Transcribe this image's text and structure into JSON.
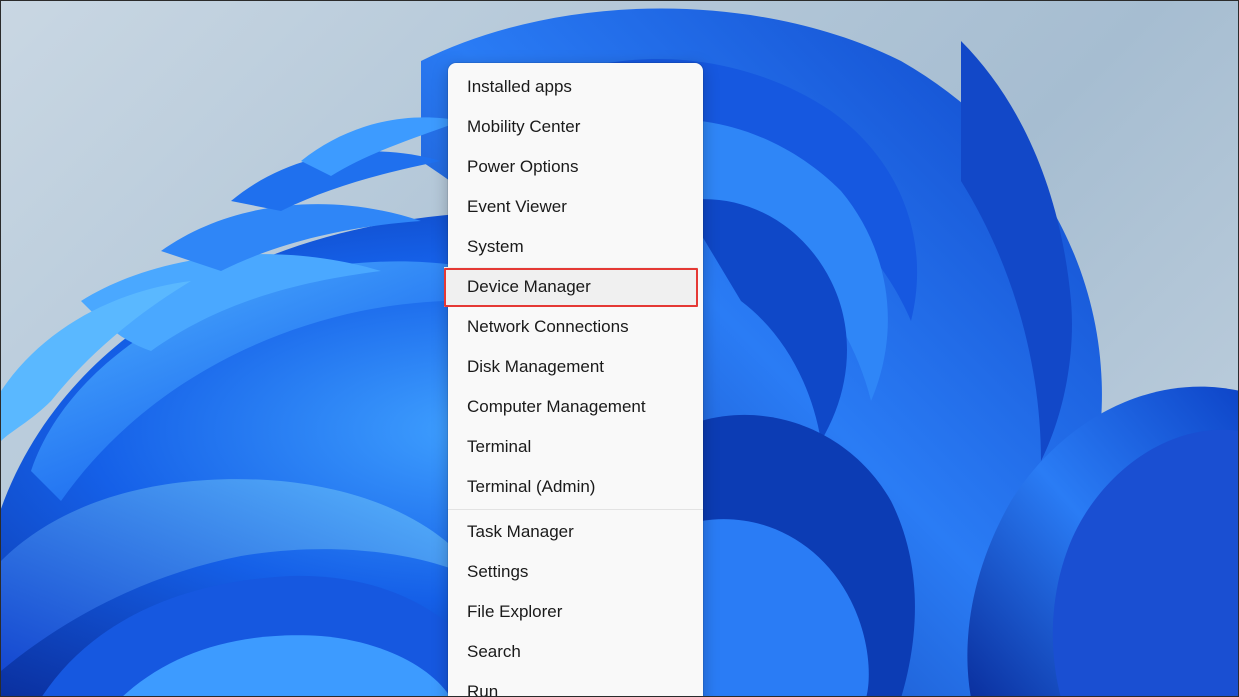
{
  "menu": {
    "group1": [
      {
        "label": "Installed apps"
      },
      {
        "label": "Mobility Center"
      },
      {
        "label": "Power Options"
      },
      {
        "label": "Event Viewer"
      },
      {
        "label": "System"
      },
      {
        "label": "Device Manager",
        "highlighted": true
      },
      {
        "label": "Network Connections"
      },
      {
        "label": "Disk Management"
      },
      {
        "label": "Computer Management"
      },
      {
        "label": "Terminal"
      },
      {
        "label": "Terminal (Admin)"
      }
    ],
    "group2": [
      {
        "label": "Task Manager"
      },
      {
        "label": "Settings"
      },
      {
        "label": "File Explorer"
      },
      {
        "label": "Search"
      },
      {
        "label": "Run"
      }
    ]
  },
  "colors": {
    "highlight_border": "#e53935",
    "menu_background": "#f9f9f9",
    "wallpaper_blue": "#1a5fe0"
  }
}
